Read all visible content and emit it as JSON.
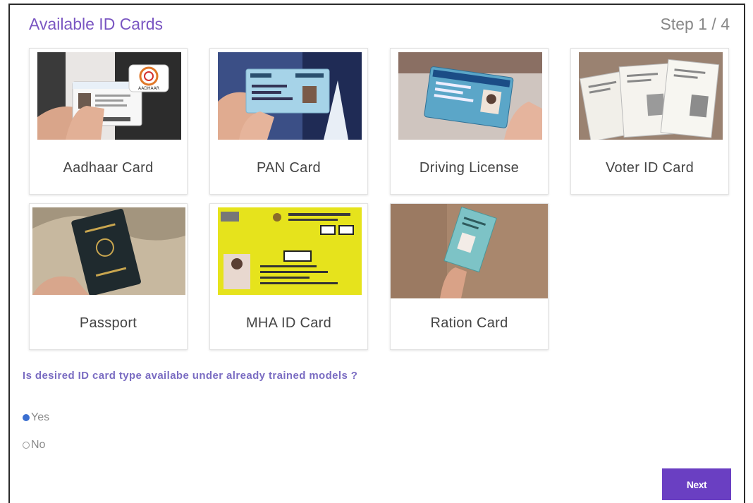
{
  "header": {
    "title": "Available ID Cards",
    "step": "Step 1 / 4"
  },
  "cards": [
    {
      "label": "Aadhaar Card",
      "image_text": "AADHAAR"
    },
    {
      "label": "PAN Card"
    },
    {
      "label": "Driving License"
    },
    {
      "label": "Voter ID Card"
    },
    {
      "label": "Passport"
    },
    {
      "label": "MHA ID Card"
    },
    {
      "label": "Ration Card"
    }
  ],
  "question": "Is desired ID card type availabe under already trained models ?",
  "options": {
    "yes": "Yes",
    "no": "No",
    "selected": "Yes"
  },
  "next_label": "Next",
  "colors": {
    "accent": "#6a3fc2",
    "title": "#7a56c2",
    "radio": "#3b6fd0"
  }
}
